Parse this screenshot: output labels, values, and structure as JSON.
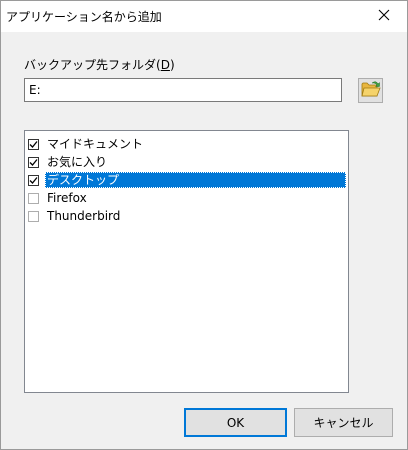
{
  "window": {
    "title": "アプリケーション名から追加"
  },
  "folder": {
    "label_prefix": "バックアップ先フォルダ(",
    "label_accel": "D",
    "label_suffix": ")",
    "value": "E:"
  },
  "list": {
    "items": [
      {
        "label": "マイドキュメント",
        "checked": true,
        "selected": false
      },
      {
        "label": "お気に入り",
        "checked": true,
        "selected": false
      },
      {
        "label": "デスクトップ",
        "checked": true,
        "selected": true
      },
      {
        "label": "Firefox",
        "checked": false,
        "selected": false
      },
      {
        "label": "Thunderbird",
        "checked": false,
        "selected": false
      }
    ]
  },
  "buttons": {
    "ok": "OK",
    "cancel": "キャンセル"
  },
  "colors": {
    "selection": "#0078d7",
    "default_button_border": "#0078d7"
  }
}
